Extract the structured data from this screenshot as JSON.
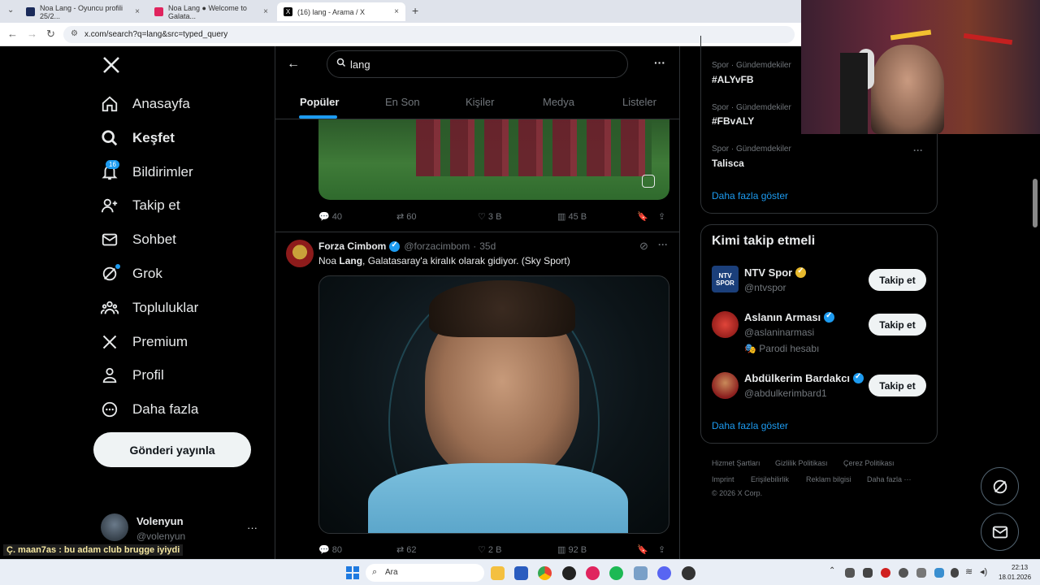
{
  "browser": {
    "tabs": [
      {
        "title": "Noa Lang - Oyuncu profili 25/2...",
        "close": "×"
      },
      {
        "title": "Noa Lang ● Welcome to Galata...",
        "close": "×"
      },
      {
        "title": "(16) lang - Arama / X",
        "close": "×"
      }
    ],
    "new_tab": "+",
    "url": "x.com/search?q=lang&src=typed_query"
  },
  "sidebar": {
    "logo": "X",
    "items": [
      {
        "label": "Anasayfa",
        "icon": "home-icon"
      },
      {
        "label": "Keşfet",
        "icon": "search-icon"
      },
      {
        "label": "Bildirimler",
        "icon": "bell-icon",
        "badge": "16"
      },
      {
        "label": "Takip et",
        "icon": "follow-icon"
      },
      {
        "label": "Sohbet",
        "icon": "mail-icon"
      },
      {
        "label": "Grok",
        "icon": "grok-icon"
      },
      {
        "label": "Topluluklar",
        "icon": "communities-icon"
      },
      {
        "label": "Premium",
        "icon": "x-premium-icon"
      },
      {
        "label": "Profil",
        "icon": "profile-icon"
      },
      {
        "label": "Daha fazla",
        "icon": "more-circle-icon"
      }
    ],
    "post_button": "Gönderi yayınla",
    "account": {
      "name": "Volenyun",
      "handle": "@volenyun",
      "more": "···"
    }
  },
  "search": {
    "query": "lang",
    "more": "···",
    "tabs": [
      "Popüler",
      "En Son",
      "Kişiler",
      "Medya",
      "Listeler"
    ]
  },
  "tweet1": {
    "replies": "40",
    "retweets": "60",
    "likes": "3 B",
    "views": "45 B"
  },
  "tweet2": {
    "author": "Forza Cimbom",
    "handle": "@forzacimbom",
    "dot": "·",
    "time": "35d",
    "text_before": "Noa ",
    "text_bold": "Lang",
    "text_after": ", Galatasaray'a kiralık olarak gidiyor. (Sky Sport)",
    "more": "···",
    "replies": "80",
    "retweets": "62",
    "likes": "2 B",
    "views": "92 B"
  },
  "trends": [
    {
      "meta": "Spor · Gündemdekiler",
      "name": "#ALYvFB"
    },
    {
      "meta": "Spor · Gündemdekiler",
      "name": "#FBvALY"
    },
    {
      "meta": "Spor · Gündemdekiler",
      "name": "Talisca",
      "more": "···"
    }
  ],
  "trends_more": "Daha fazla göster",
  "who_to_follow": {
    "title": "Kimi takip etmeli",
    "users": [
      {
        "name": "NTV Spor",
        "handle": "@ntvspor",
        "button": "Takip et",
        "avatar_text": "NTV SPOR"
      },
      {
        "name": "Aslanın Arması",
        "handle": "@aslaninarmasi",
        "extra": "Parodi hesabı",
        "button": "Takip et"
      },
      {
        "name": "Abdülkerim Bardakcı",
        "handle": "@abdulkerimbard1",
        "button": "Takip et"
      }
    ],
    "more": "Daha fazla göster"
  },
  "footer": {
    "links": [
      "Hizmet Şartları",
      "Gizlilik Politikası",
      "Çerez Politikası",
      "Imprint",
      "Erişilebilirlik",
      "Reklam bilgisi",
      "Daha fazla ···"
    ],
    "copyright": "© 2026 X Corp."
  },
  "overlay": {
    "chat_line": "Ç. maan7as : bu adam club brugge iyiydi"
  },
  "taskbar": {
    "search": "Ara",
    "time": "22:13",
    "date": "18.01.2026"
  },
  "colors": {
    "accent": "#1d9bf0",
    "background": "#000000",
    "secondary_text": "#71767b"
  }
}
